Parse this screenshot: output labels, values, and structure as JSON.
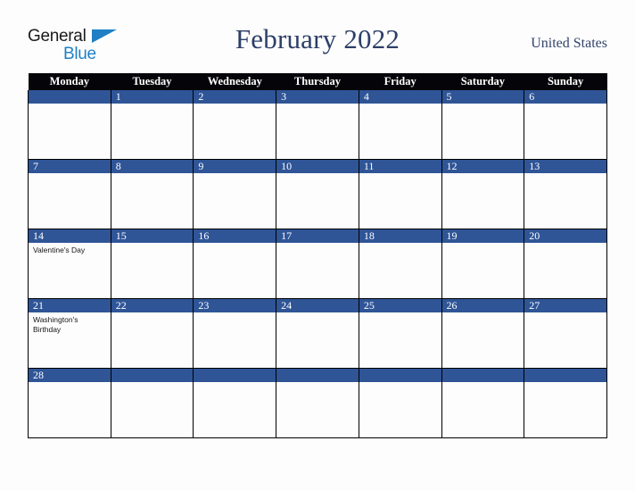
{
  "brand": {
    "name_part1": "General",
    "name_part2": "Blue",
    "triangle_icon": "triangle-icon",
    "accent_color": "#1f7fc4"
  },
  "header": {
    "title": "February 2022",
    "country": "United States",
    "title_color": "#2d3f68"
  },
  "calendar": {
    "header_bg": "#050509",
    "daynum_bg": "#2f5597",
    "cell_bg": "#fdfdfd",
    "weekdays": [
      "Monday",
      "Tuesday",
      "Wednesday",
      "Thursday",
      "Friday",
      "Saturday",
      "Sunday"
    ],
    "weeks": [
      [
        {
          "day": "",
          "events": []
        },
        {
          "day": "1",
          "events": []
        },
        {
          "day": "2",
          "events": []
        },
        {
          "day": "3",
          "events": []
        },
        {
          "day": "4",
          "events": []
        },
        {
          "day": "5",
          "events": []
        },
        {
          "day": "6",
          "events": []
        }
      ],
      [
        {
          "day": "7",
          "events": []
        },
        {
          "day": "8",
          "events": []
        },
        {
          "day": "9",
          "events": []
        },
        {
          "day": "10",
          "events": []
        },
        {
          "day": "11",
          "events": []
        },
        {
          "day": "12",
          "events": []
        },
        {
          "day": "13",
          "events": []
        }
      ],
      [
        {
          "day": "14",
          "events": [
            "Valentine's Day"
          ]
        },
        {
          "day": "15",
          "events": []
        },
        {
          "day": "16",
          "events": []
        },
        {
          "day": "17",
          "events": []
        },
        {
          "day": "18",
          "events": []
        },
        {
          "day": "19",
          "events": []
        },
        {
          "day": "20",
          "events": []
        }
      ],
      [
        {
          "day": "21",
          "events": [
            "Washington's Birthday"
          ]
        },
        {
          "day": "22",
          "events": []
        },
        {
          "day": "23",
          "events": []
        },
        {
          "day": "24",
          "events": []
        },
        {
          "day": "25",
          "events": []
        },
        {
          "day": "26",
          "events": []
        },
        {
          "day": "27",
          "events": []
        }
      ],
      [
        {
          "day": "28",
          "events": []
        },
        {
          "day": "",
          "events": []
        },
        {
          "day": "",
          "events": []
        },
        {
          "day": "",
          "events": []
        },
        {
          "day": "",
          "events": []
        },
        {
          "day": "",
          "events": []
        },
        {
          "day": "",
          "events": []
        }
      ]
    ]
  }
}
